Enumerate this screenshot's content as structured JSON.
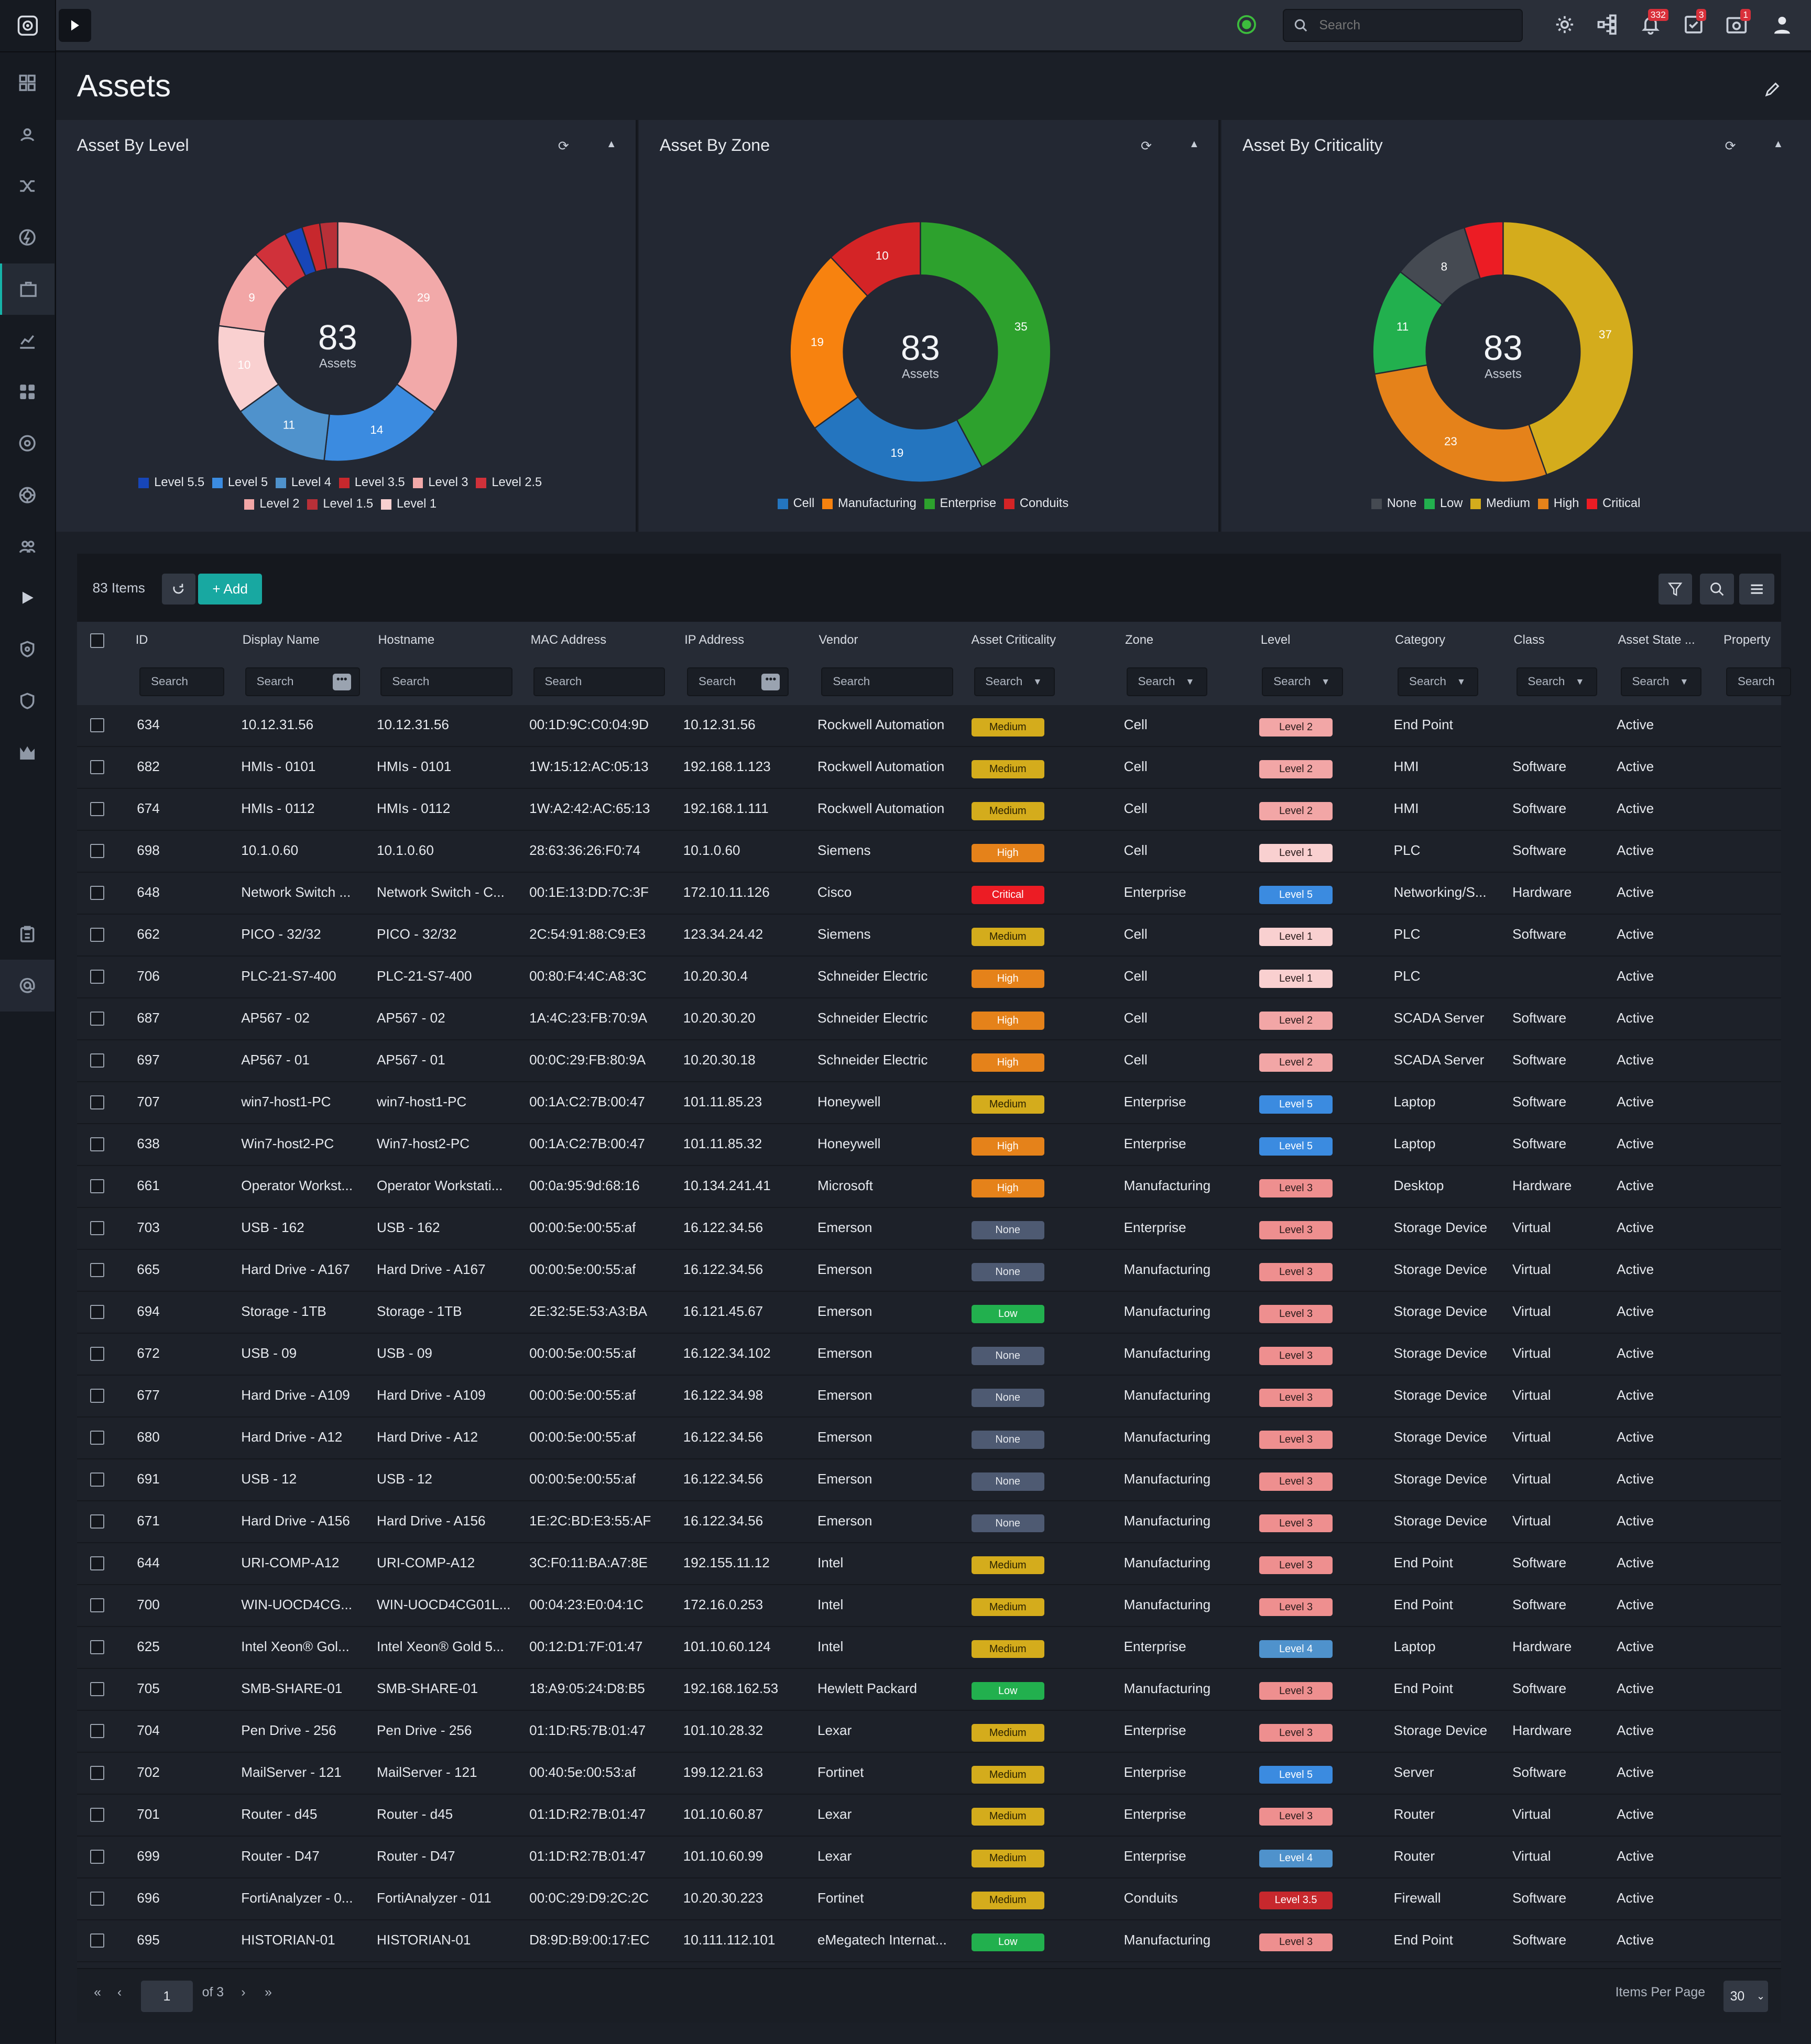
{
  "topbar": {
    "search_placeholder": "Search",
    "alerts_badge": "332",
    "tasks_badge": "3",
    "notifications_badge": "1"
  },
  "page": {
    "title": "Assets"
  },
  "widgets": [
    {
      "title": "Asset By Level",
      "center_value": "83",
      "center_label": "Assets",
      "legend": [
        {
          "label": "Level 5.5",
          "color": "#1746b8"
        },
        {
          "label": "Level 5",
          "color": "#3b8be0"
        },
        {
          "label": "Level 4",
          "color": "#4f92cc"
        },
        {
          "label": "Level 3.5",
          "color": "#c7282d"
        },
        {
          "label": "Level 3",
          "color": "#f2a9a9"
        },
        {
          "label": "Level 2.5",
          "color": "#d0313a"
        },
        {
          "label": "Level 2",
          "color": "#f2a6a6"
        },
        {
          "label": "Level 1.5",
          "color": "#b83038"
        },
        {
          "label": "Level 1",
          "color": "#f9d0d0"
        }
      ],
      "slices": [
        {
          "value": 29,
          "label": "29",
          "color": "#f2a9a9"
        },
        {
          "value": 14,
          "label": "14",
          "color": "#3b8be0"
        },
        {
          "value": 11,
          "label": "11",
          "color": "#4f92cc"
        },
        {
          "value": 10,
          "label": "10",
          "color": "#f9d0d0"
        },
        {
          "value": 9,
          "label": "9",
          "color": "#f2a6a6"
        },
        {
          "value": 4,
          "label": "",
          "color": "#d0313a"
        },
        {
          "value": 2,
          "label": "",
          "color": "#1746b8"
        },
        {
          "value": 2,
          "label": "",
          "color": "#c7282d"
        },
        {
          "value": 2,
          "label": "",
          "color": "#b83038"
        }
      ]
    },
    {
      "title": "Asset By Zone",
      "center_value": "83",
      "center_label": "Assets",
      "legend": [
        {
          "label": "Cell",
          "color": "#2475bf"
        },
        {
          "label": "Manufacturing",
          "color": "#f7820f"
        },
        {
          "label": "Enterprise",
          "color": "#2da12d"
        },
        {
          "label": "Conduits",
          "color": "#d42426"
        }
      ],
      "slices": [
        {
          "value": 35,
          "label": "35",
          "color": "#2da12d"
        },
        {
          "value": 19,
          "label": "19",
          "color": "#2475bf"
        },
        {
          "value": 19,
          "label": "19",
          "color": "#f7820f"
        },
        {
          "value": 10,
          "label": "10",
          "color": "#d42426"
        }
      ]
    },
    {
      "title": "Asset By Criticality",
      "center_value": "83",
      "center_label": "Assets",
      "legend": [
        {
          "label": "None",
          "color": "#454a52"
        },
        {
          "label": "Low",
          "color": "#22b04e"
        },
        {
          "label": "Medium",
          "color": "#d4ac1c"
        },
        {
          "label": "High",
          "color": "#e5821a"
        },
        {
          "label": "Critical",
          "color": "#ec1c24"
        }
      ],
      "slices": [
        {
          "value": 37,
          "label": "37",
          "color": "#d4ac1c"
        },
        {
          "value": 23,
          "label": "23",
          "color": "#e5821a"
        },
        {
          "value": 11,
          "label": "11",
          "color": "#22b04e"
        },
        {
          "value": 8,
          "label": "8",
          "color": "#454a52"
        },
        {
          "value": 4,
          "label": "",
          "color": "#ec1c24"
        }
      ]
    }
  ],
  "table": {
    "count_label": "83 Items",
    "add_label": "+ Add",
    "filter_placeholder": "Search",
    "headers": [
      "ID",
      "Display Name",
      "Hostname",
      "MAC Address",
      "IP Address",
      "Vendor",
      "Asset Criticality",
      "Zone",
      "Level",
      "Category",
      "Class",
      "Asset State ...",
      "Property"
    ],
    "rows": [
      [
        "634",
        "10.12.31.56",
        "10.12.31.56",
        "00:1D:9C:C0:04:9D",
        "10.12.31.56",
        "Rockwell Automation",
        "Medium",
        "Cell",
        "Level 2",
        "End Point",
        "",
        "Active"
      ],
      [
        "682",
        "HMIs - 0101",
        "HMIs - 0101",
        "1W:15:12:AC:05:13",
        "192.168.1.123",
        "Rockwell Automation",
        "Medium",
        "Cell",
        "Level 2",
        "HMI",
        "Software",
        "Active"
      ],
      [
        "674",
        "HMIs - 0112",
        "HMIs - 0112",
        "1W:A2:42:AC:65:13",
        "192.168.1.111",
        "Rockwell Automation",
        "Medium",
        "Cell",
        "Level 2",
        "HMI",
        "Software",
        "Active"
      ],
      [
        "698",
        "10.1.0.60",
        "10.1.0.60",
        "28:63:36:26:F0:74",
        "10.1.0.60",
        "Siemens",
        "High",
        "Cell",
        "Level 1",
        "PLC",
        "Software",
        "Active"
      ],
      [
        "648",
        "Network Switch ...",
        "Network Switch - C...",
        "00:1E:13:DD:7C:3F",
        "172.10.11.126",
        "Cisco",
        "Critical",
        "Enterprise",
        "Level 5",
        "Networking/S...",
        "Hardware",
        "Active"
      ],
      [
        "662",
        "PICO - 32/32",
        "PICO - 32/32",
        "2C:54:91:88:C9:E3",
        "123.34.24.42",
        "Siemens",
        "Medium",
        "Cell",
        "Level 1",
        "PLC",
        "Software",
        "Active"
      ],
      [
        "706",
        "PLC-21-S7-400",
        "PLC-21-S7-400",
        "00:80:F4:4C:A8:3C",
        "10.20.30.4",
        "Schneider Electric",
        "High",
        "Cell",
        "Level 1",
        "PLC",
        "",
        "Active"
      ],
      [
        "687",
        "AP567 - 02",
        "AP567 - 02",
        "1A:4C:23:FB:70:9A",
        "10.20.30.20",
        "Schneider Electric",
        "High",
        "Cell",
        "Level 2",
        "SCADA Server",
        "Software",
        "Active"
      ],
      [
        "697",
        "AP567 - 01",
        "AP567 - 01",
        "00:0C:29:FB:80:9A",
        "10.20.30.18",
        "Schneider Electric",
        "High",
        "Cell",
        "Level 2",
        "SCADA Server",
        "Software",
        "Active"
      ],
      [
        "707",
        "win7-host1-PC",
        "win7-host1-PC",
        "00:1A:C2:7B:00:47",
        "101.11.85.23",
        "Honeywell",
        "Medium",
        "Enterprise",
        "Level 5",
        "Laptop",
        "Software",
        "Active"
      ],
      [
        "638",
        "Win7-host2-PC",
        "Win7-host2-PC",
        "00:1A:C2:7B:00:47",
        "101.11.85.32",
        "Honeywell",
        "High",
        "Enterprise",
        "Level 5",
        "Laptop",
        "Software",
        "Active"
      ],
      [
        "661",
        "Operator Workst...",
        "Operator Workstati...",
        "00:0a:95:9d:68:16",
        "10.134.241.41",
        "Microsoft",
        "High",
        "Manufacturing",
        "Level 3",
        "Desktop",
        "Hardware",
        "Active"
      ],
      [
        "703",
        "USB - 162",
        "USB - 162",
        "00:00:5e:00:55:af",
        "16.122.34.56",
        "Emerson",
        "None",
        "Enterprise",
        "Level 3",
        "Storage Device",
        "Virtual",
        "Active"
      ],
      [
        "665",
        "Hard Drive - A167",
        "Hard Drive - A167",
        "00:00:5e:00:55:af",
        "16.122.34.56",
        "Emerson",
        "None",
        "Manufacturing",
        "Level 3",
        "Storage Device",
        "Virtual",
        "Active"
      ],
      [
        "694",
        "Storage - 1TB",
        "Storage - 1TB",
        "2E:32:5E:53:A3:BA",
        "16.121.45.67",
        "Emerson",
        "Low",
        "Manufacturing",
        "Level 3",
        "Storage Device",
        "Virtual",
        "Active"
      ],
      [
        "672",
        "USB - 09",
        "USB - 09",
        "00:00:5e:00:55:af",
        "16.122.34.102",
        "Emerson",
        "None",
        "Manufacturing",
        "Level 3",
        "Storage Device",
        "Virtual",
        "Active"
      ],
      [
        "677",
        "Hard Drive - A109",
        "Hard Drive - A109",
        "00:00:5e:00:55:af",
        "16.122.34.98",
        "Emerson",
        "None",
        "Manufacturing",
        "Level 3",
        "Storage Device",
        "Virtual",
        "Active"
      ],
      [
        "680",
        "Hard Drive - A12",
        "Hard Drive - A12",
        "00:00:5e:00:55:af",
        "16.122.34.56",
        "Emerson",
        "None",
        "Manufacturing",
        "Level 3",
        "Storage Device",
        "Virtual",
        "Active"
      ],
      [
        "691",
        "USB - 12",
        "USB - 12",
        "00:00:5e:00:55:af",
        "16.122.34.56",
        "Emerson",
        "None",
        "Manufacturing",
        "Level 3",
        "Storage Device",
        "Virtual",
        "Active"
      ],
      [
        "671",
        "Hard Drive - A156",
        "Hard Drive - A156",
        "1E:2C:BD:E3:55:AF",
        "16.122.34.56",
        "Emerson",
        "None",
        "Manufacturing",
        "Level 3",
        "Storage Device",
        "Virtual",
        "Active"
      ],
      [
        "644",
        "URI-COMP-A12",
        "URI-COMP-A12",
        "3C:F0:11:BA:A7:8E",
        "192.155.11.12",
        "Intel",
        "Medium",
        "Manufacturing",
        "Level 3",
        "End Point",
        "Software",
        "Active"
      ],
      [
        "700",
        "WIN-UOCD4CG...",
        "WIN-UOCD4CG01L...",
        "00:04:23:E0:04:1C",
        "172.16.0.253",
        "Intel",
        "Medium",
        "Manufacturing",
        "Level 3",
        "End Point",
        "Software",
        "Active"
      ],
      [
        "625",
        "Intel Xeon® Gol...",
        "Intel Xeon® Gold 5...",
        "00:12:D1:7F:01:47",
        "101.10.60.124",
        "Intel",
        "Medium",
        "Enterprise",
        "Level 4",
        "Laptop",
        "Hardware",
        "Active"
      ],
      [
        "705",
        "SMB-SHARE-01",
        "SMB-SHARE-01",
        "18:A9:05:24:D8:B5",
        "192.168.162.53",
        "Hewlett Packard",
        "Low",
        "Manufacturing",
        "Level 3",
        "End Point",
        "Software",
        "Active"
      ],
      [
        "704",
        "Pen Drive - 256",
        "Pen Drive - 256",
        "01:1D:R5:7B:01:47",
        "101.10.28.32",
        "Lexar",
        "Medium",
        "Enterprise",
        "Level 3",
        "Storage Device",
        "Hardware",
        "Active"
      ],
      [
        "702",
        "MailServer - 121",
        "MailServer - 121",
        "00:40:5e:00:53:af",
        "199.12.21.63",
        "Fortinet",
        "Medium",
        "Enterprise",
        "Level 5",
        "Server",
        "Software",
        "Active"
      ],
      [
        "701",
        "Router - d45",
        "Router - d45",
        "01:1D:R2:7B:01:47",
        "101.10.60.87",
        "Lexar",
        "Medium",
        "Enterprise",
        "Level 3",
        "Router",
        "Virtual",
        "Active"
      ],
      [
        "699",
        "Router - D47",
        "Router - D47",
        "01:1D:R2:7B:01:47",
        "101.10.60.99",
        "Lexar",
        "Medium",
        "Enterprise",
        "Level 4",
        "Router",
        "Virtual",
        "Active"
      ],
      [
        "696",
        "FortiAnalyzer - 0...",
        "FortiAnalyzer - 011",
        "00:0C:29:D9:2C:2C",
        "10.20.30.223",
        "Fortinet",
        "Medium",
        "Conduits",
        "Level 3.5",
        "Firewall",
        "Software",
        "Active"
      ],
      [
        "695",
        "HISTORIAN-01",
        "HISTORIAN-01",
        "D8:9D:B9:00:17:EC",
        "10.111.112.101",
        "eMegatech Internat...",
        "Low",
        "Manufacturing",
        "Level 3",
        "End Point",
        "Software",
        "Active"
      ]
    ]
  },
  "criticality_styles": {
    "Medium": {
      "bg": "#d4ac1c",
      "fg": "#2a2100"
    },
    "High": {
      "bg": "#e5821a",
      "fg": "#ffffff"
    },
    "Critical": {
      "bg": "#ec1c24",
      "fg": "#ffffff"
    },
    "None": {
      "bg": "#4e5a72",
      "fg": "#e6e9ee"
    },
    "Low": {
      "bg": "#22b04e",
      "fg": "#ffffff"
    }
  },
  "level_styles": {
    "Level 1": {
      "bg": "#f9d0d0",
      "fg": "#2a1b1b"
    },
    "Level 2": {
      "bg": "#f2a6a6",
      "fg": "#2a1b1b"
    },
    "Level 3": {
      "bg": "#ee8f8f",
      "fg": "#2a1b1b"
    },
    "Level 3.5": {
      "bg": "#c7282d",
      "fg": "#ffffff"
    },
    "Level 4": {
      "bg": "#4f92cc",
      "fg": "#ffffff"
    },
    "Level 5": {
      "bg": "#3b8be0",
      "fg": "#ffffff"
    }
  },
  "pagination": {
    "current_page": "1",
    "of_label": "of 3",
    "items_per_page_label": "Items Per Page",
    "items_per_page": "30"
  }
}
